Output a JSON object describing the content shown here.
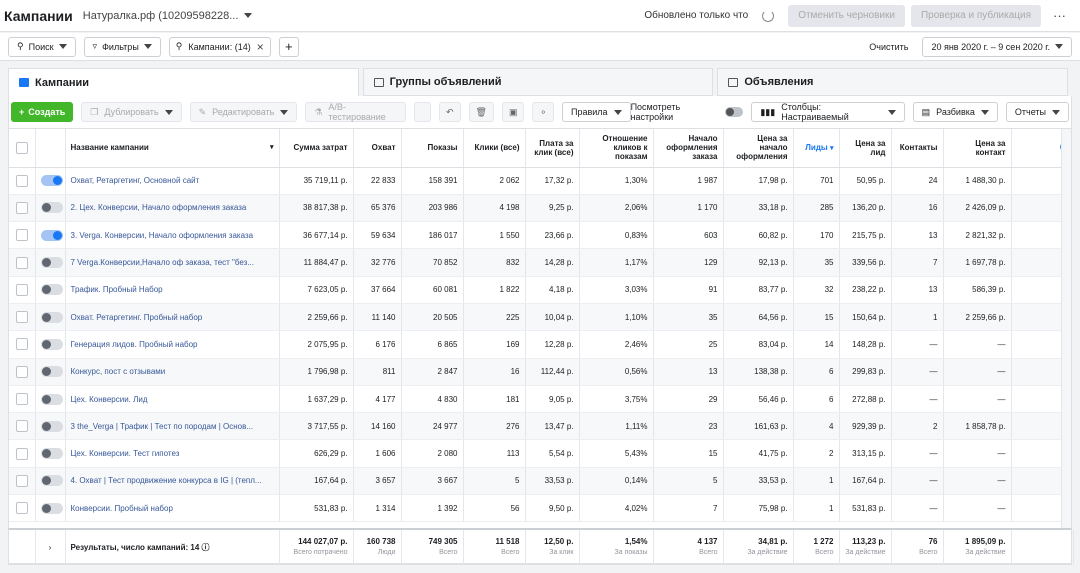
{
  "topbar": {
    "title": "Кампании",
    "account": "Натуралка.рф (10209598228...",
    "updated_label": "Обновлено только что",
    "discard_label": "Отменить черновики",
    "review_label": "Проверка и публикация",
    "more": "···"
  },
  "filterbar": {
    "search_label": "Поиск",
    "filters_label": "Фильтры",
    "chip_label": "Кампании: (14)",
    "add": "+",
    "clear_label": "Очистить",
    "date_range": "20 янв 2020 г. – 9 сен 2020 г."
  },
  "tabs": {
    "campaigns": "Кампании",
    "adsets": "Группы объявлений",
    "ads": "Объявления"
  },
  "toolbar": {
    "create_label": "Создать",
    "duplicate_label": "Дублировать",
    "edit_label": "Редактировать",
    "ab_label": "A/B-тестирование",
    "rules_label": "Правила",
    "view_settings_label": "Посмотреть настройки",
    "columns_label": "Столбцы: Настраиваемый",
    "breakdown_label": "Разбивка",
    "reports_label": "Отчеты"
  },
  "columns": [
    "Название кампании",
    "Сумма затрат",
    "Охват",
    "Показы",
    "Клики (все)",
    "Плата за клик (все)",
    "Отношение кликов к показам",
    "Начало оформления заказа",
    "Цена за начало оформления",
    "Лиды",
    "Цена за лид",
    "Контакты",
    "Цена за контакт"
  ],
  "rows": [
    {
      "on": true,
      "name": "Охват, Ретаргетинг, Основной сайт",
      "spend": "35 719,11 р.",
      "reach": "22 833",
      "impr": "158 391",
      "clicks": "2 062",
      "cpc": "17,32 р.",
      "ctr": "1,30%",
      "checkout": "1 987",
      "cost_checkout": "17,98 р.",
      "leads": "701",
      "cpl": "50,95 р.",
      "contacts": "24",
      "cost_contact": "1 488,30 р."
    },
    {
      "on": false,
      "name": "2. Цех. Конверсии, Начало оформления заказа",
      "spend": "38 817,38 р.",
      "reach": "65 376",
      "impr": "203 986",
      "clicks": "4 198",
      "cpc": "9,25 р.",
      "ctr": "2,06%",
      "checkout": "1 170",
      "cost_checkout": "33,18 р.",
      "leads": "285",
      "cpl": "136,20 р.",
      "contacts": "16",
      "cost_contact": "2 426,09 р."
    },
    {
      "on": true,
      "name": "3. Verga. Конверсии, Начало оформления заказа",
      "spend": "36 677,14 р.",
      "reach": "59 634",
      "impr": "186 017",
      "clicks": "1 550",
      "cpc": "23,66 р.",
      "ctr": "0,83%",
      "checkout": "603",
      "cost_checkout": "60,82 р.",
      "leads": "170",
      "cpl": "215,75 р.",
      "contacts": "13",
      "cost_contact": "2 821,32 р."
    },
    {
      "on": false,
      "name": "7 Verga.Конверсии,Начало оф заказа, тест \"без...",
      "spend": "11 884,47 р.",
      "reach": "32 776",
      "impr": "70 852",
      "clicks": "832",
      "cpc": "14,28 р.",
      "ctr": "1,17%",
      "checkout": "129",
      "cost_checkout": "92,13 р.",
      "leads": "35",
      "cpl": "339,56 р.",
      "contacts": "7",
      "cost_contact": "1 697,78 р."
    },
    {
      "on": false,
      "name": "Трафик. Пробный Набор",
      "spend": "7 623,05 р.",
      "reach": "37 664",
      "impr": "60 081",
      "clicks": "1 822",
      "cpc": "4,18 р.",
      "ctr": "3,03%",
      "checkout": "91",
      "cost_checkout": "83,77 р.",
      "leads": "32",
      "cpl": "238,22 р.",
      "contacts": "13",
      "cost_contact": "586,39 р."
    },
    {
      "on": false,
      "name": "Охват. Ретаргетинг. Пробный набор",
      "spend": "2 259,66 р.",
      "reach": "11 140",
      "impr": "20 505",
      "clicks": "225",
      "cpc": "10,04 р.",
      "ctr": "1,10%",
      "checkout": "35",
      "cost_checkout": "64,56 р.",
      "leads": "15",
      "cpl": "150,64 р.",
      "contacts": "1",
      "cost_contact": "2 259,66 р."
    },
    {
      "on": false,
      "name": "Генерация лидов. Пробный набор",
      "spend": "2 075,95 р.",
      "reach": "6 176",
      "impr": "6 865",
      "clicks": "169",
      "cpc": "12,28 р.",
      "ctr": "2,46%",
      "checkout": "25",
      "cost_checkout": "83,04 р.",
      "leads": "14",
      "cpl": "148,28 р.",
      "contacts": "—",
      "cost_contact": "—"
    },
    {
      "on": false,
      "name": "Конкурс, пост с отзывами",
      "spend": "1 796,98 р.",
      "reach": "811",
      "impr": "2 847",
      "clicks": "16",
      "cpc": "112,44 р.",
      "ctr": "0,56%",
      "checkout": "13",
      "cost_checkout": "138,38 р.",
      "leads": "6",
      "cpl": "299,83 р.",
      "contacts": "—",
      "cost_contact": "—"
    },
    {
      "on": false,
      "name": "Цех. Конверсии. Лид",
      "spend": "1 637,29 р.",
      "reach": "4 177",
      "impr": "4 830",
      "clicks": "181",
      "cpc": "9,05 р.",
      "ctr": "3,75%",
      "checkout": "29",
      "cost_checkout": "56,46 р.",
      "leads": "6",
      "cpl": "272,88 р.",
      "contacts": "—",
      "cost_contact": "—"
    },
    {
      "on": false,
      "name": "3 the_Verga | Трафик | Тест по породам | Основ...",
      "spend": "3 717,55 р.",
      "reach": "14 160",
      "impr": "24 977",
      "clicks": "276",
      "cpc": "13,47 р.",
      "ctr": "1,11%",
      "checkout": "23",
      "cost_checkout": "161,63 р.",
      "leads": "4",
      "cpl": "929,39 р.",
      "contacts": "2",
      "cost_contact": "1 858,78 р."
    },
    {
      "on": false,
      "name": "Цех. Конверсии. Тест гипотез",
      "spend": "626,29 р.",
      "reach": "1 606",
      "impr": "2 080",
      "clicks": "113",
      "cpc": "5,54 р.",
      "ctr": "5,43%",
      "checkout": "15",
      "cost_checkout": "41,75 р.",
      "leads": "2",
      "cpl": "313,15 р.",
      "contacts": "—",
      "cost_contact": "—"
    },
    {
      "on": false,
      "name": "4. Охват | Тест продвижение конкурса в IG | (тепл...",
      "spend": "167,64 р.",
      "reach": "3 657",
      "impr": "3 667",
      "clicks": "5",
      "cpc": "33,53 р.",
      "ctr": "0,14%",
      "checkout": "5",
      "cost_checkout": "33,53 р.",
      "leads": "1",
      "cpl": "167,64 р.",
      "contacts": "—",
      "cost_contact": "—"
    },
    {
      "on": false,
      "name": "Конверсии. Пробный набор",
      "spend": "531,83 р.",
      "reach": "1 314",
      "impr": "1 392",
      "clicks": "56",
      "cpc": "9,50 р.",
      "ctr": "4,02%",
      "checkout": "7",
      "cost_checkout": "75,98 р.",
      "leads": "1",
      "cpl": "531,83 р.",
      "contacts": "—",
      "cost_contact": "—"
    }
  ],
  "totals": {
    "label": "Результаты, число кампаний: 14",
    "spend": {
      "value": "144 027,07 р.",
      "note": "Всего потрачено"
    },
    "reach": {
      "value": "160 738",
      "note": "Люди"
    },
    "impr": {
      "value": "749 305",
      "note": "Всего"
    },
    "clicks": {
      "value": "11 518",
      "note": "Всего"
    },
    "cpc": {
      "value": "12,50 р.",
      "note": "За клик"
    },
    "ctr": {
      "value": "1,54%",
      "note": "За показы"
    },
    "checkout": {
      "value": "4 137",
      "note": "Всего"
    },
    "cost_checkout": {
      "value": "34,81 р.",
      "note": "За действие"
    },
    "leads": {
      "value": "1 272",
      "note": "Всего"
    },
    "cpl": {
      "value": "113,23 р.",
      "note": "За действие"
    },
    "contacts": {
      "value": "76",
      "note": "Всего"
    },
    "cost_contact": {
      "value": "1 895,09 р.",
      "note": "За действие"
    }
  },
  "colors": {
    "accent": "#1877f2",
    "create": "#42b72a"
  }
}
